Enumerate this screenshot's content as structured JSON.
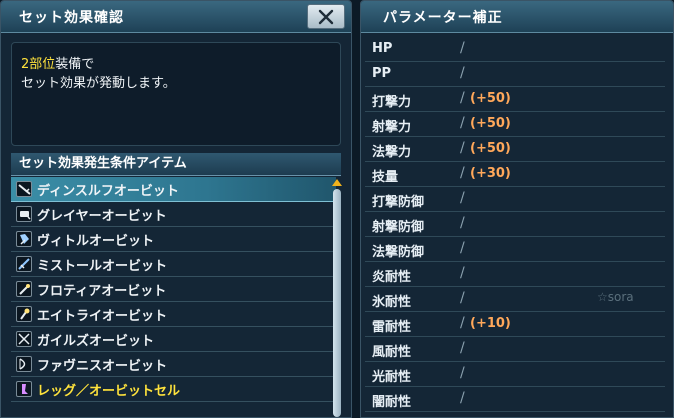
{
  "set_panel": {
    "title": "セット効果確認",
    "close_label": "✕",
    "description": {
      "line1_highlight": "2部位",
      "line1_rest": "装備で",
      "line2": "セット効果が発動します。"
    },
    "list_title": "セット効果発生条件アイテム",
    "items": [
      {
        "name": "ディンスルフオービット",
        "icon": "rifle-icon"
      },
      {
        "name": "グレイヤーオービット",
        "icon": "launcher-icon"
      },
      {
        "name": "ヴィトルオービット",
        "icon": "talis-icon"
      },
      {
        "name": "ミストールオービット",
        "icon": "knuckle-icon"
      },
      {
        "name": "フロティアオービット",
        "icon": "rod-icon"
      },
      {
        "name": "エイトライオービット",
        "icon": "wand-icon"
      },
      {
        "name": "ガイルズオービット",
        "icon": "twin-daggers-icon"
      },
      {
        "name": "ファヴニスオービット",
        "icon": "bow-icon"
      },
      {
        "name": "レッグ／オービットセル",
        "icon": "leg-unit-icon"
      }
    ],
    "selected_index": 0,
    "highlight_color": "#ffe33c"
  },
  "param_panel": {
    "title": "パラメーター補正",
    "rows": [
      {
        "label": "HP",
        "slash": "/",
        "value": ""
      },
      {
        "label": "PP",
        "slash": "/",
        "value": ""
      },
      {
        "label": "打撃力",
        "slash": "/",
        "value": "(+50)"
      },
      {
        "label": "射撃力",
        "slash": "/",
        "value": "(+50)"
      },
      {
        "label": "法撃力",
        "slash": "/",
        "value": "(+50)"
      },
      {
        "label": "技量",
        "slash": "/",
        "value": "(+30)"
      },
      {
        "label": "打撃防御",
        "slash": "/",
        "value": ""
      },
      {
        "label": "射撃防御",
        "slash": "/",
        "value": ""
      },
      {
        "label": "法撃防御",
        "slash": "/",
        "value": ""
      },
      {
        "label": "炎耐性",
        "slash": "/",
        "value": ""
      },
      {
        "label": "氷耐性",
        "slash": "/",
        "value": ""
      },
      {
        "label": "雷耐性",
        "slash": "/",
        "value": "(+10)"
      },
      {
        "label": "風耐性",
        "slash": "/",
        "value": ""
      },
      {
        "label": "光耐性",
        "slash": "/",
        "value": ""
      },
      {
        "label": "闇耐性",
        "slash": "/",
        "value": ""
      }
    ],
    "value_color": "#ffa85a",
    "watermark": "☆sora"
  }
}
